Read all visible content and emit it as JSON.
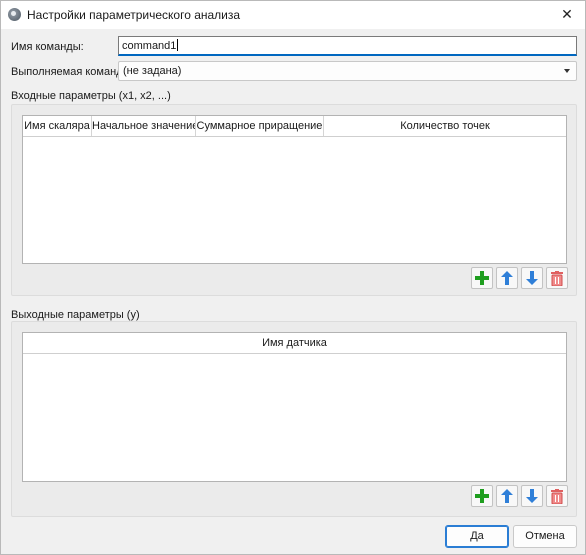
{
  "window": {
    "title": "Настройки параметрического анализа",
    "close_glyph": "✕"
  },
  "form": {
    "command_name_label": "Имя команды:",
    "command_name_value": "command1",
    "command_label": "Выполняемая команда:",
    "command_value": "(не задана)"
  },
  "inputs_group": {
    "title": "Входные параметры (x1, x2, ...)",
    "columns": [
      "Имя скаляра",
      "Начальное значение",
      "Суммарное приращение",
      "Количество точек"
    ]
  },
  "outputs_group": {
    "title": "Выходные параметры (y)",
    "columns": [
      "Имя датчика"
    ]
  },
  "toolbar_icons": [
    "add-icon",
    "move-up-icon",
    "move-down-icon",
    "delete-icon"
  ],
  "buttons": {
    "ok": "Да",
    "cancel": "Отмена"
  },
  "colors": {
    "add": "#1f9e1f",
    "arrow": "#2f7fd8",
    "delete": "#e06060",
    "accent": "#0067c0"
  }
}
